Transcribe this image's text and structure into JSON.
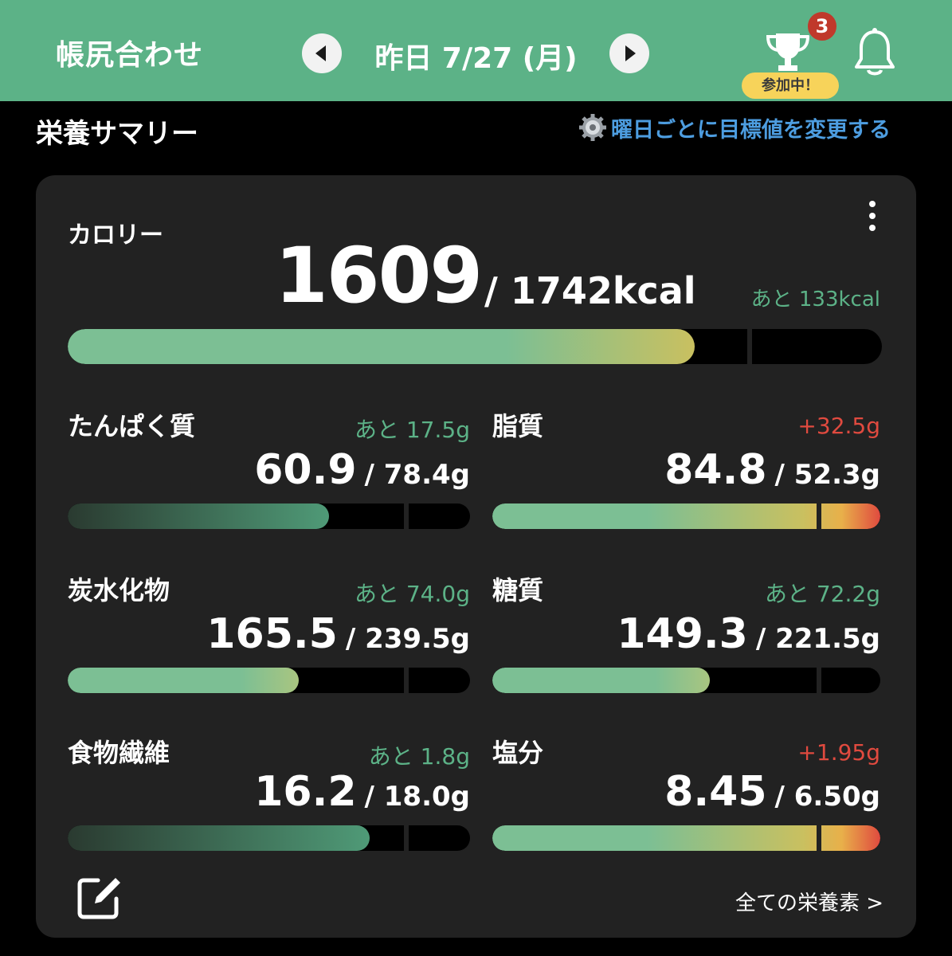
{
  "header": {
    "title": "帳尻合わせ",
    "date": "昨日 7/27 (月)",
    "trophy_badge_count": "3",
    "challenge_status": "参加中！",
    "icons": [
      "chevron-left-icon",
      "chevron-right-icon",
      "trophy-icon",
      "bell-icon"
    ],
    "color": "#5cb287"
  },
  "summary": {
    "title": "栄養サマリー",
    "goal_link": "曜日ごとに目標値を変更する",
    "goal_link_color": "#4d9de0"
  },
  "calories": {
    "label": "カロリー",
    "value": "1609",
    "target": "/ 1742kcal",
    "remaining": "あと 133kcal",
    "progress": 0.77,
    "marker": 0.835
  },
  "nutrients": [
    {
      "name": "たんぱく質",
      "remaining": "あと 17.5g",
      "over": false,
      "value": "60.9",
      "target": "/ 78.4g",
      "progress": 0.65,
      "marker": 0.835,
      "style": "dark-grad"
    },
    {
      "name": "脂質",
      "remaining": "+32.5g",
      "over": true,
      "value": "84.8",
      "target": "/ 52.3g",
      "progress": 1.0,
      "marker": 0.835,
      "style": "over-grad"
    },
    {
      "name": "炭水化物",
      "remaining": "あと 74.0g",
      "over": false,
      "value": "165.5",
      "target": "/ 239.5g",
      "progress": 0.575,
      "marker": 0.835,
      "style": "light"
    },
    {
      "name": "糖質",
      "remaining": "あと 72.2g",
      "over": false,
      "value": "149.3",
      "target": "/ 221.5g",
      "progress": 0.56,
      "marker": 0.835,
      "style": "light"
    },
    {
      "name": "食物繊維",
      "remaining": "あと 1.8g",
      "over": false,
      "value": "16.2",
      "target": "/ 18.0g",
      "progress": 0.75,
      "marker": 0.835,
      "style": "dark-grad"
    },
    {
      "name": "塩分",
      "remaining": "+1.95g",
      "over": true,
      "value": "8.45",
      "target": "/ 6.50g",
      "progress": 1.0,
      "marker": 0.835,
      "style": "over-grad"
    }
  ],
  "footer": {
    "all_nutrients_link": "全ての栄養素 >"
  }
}
